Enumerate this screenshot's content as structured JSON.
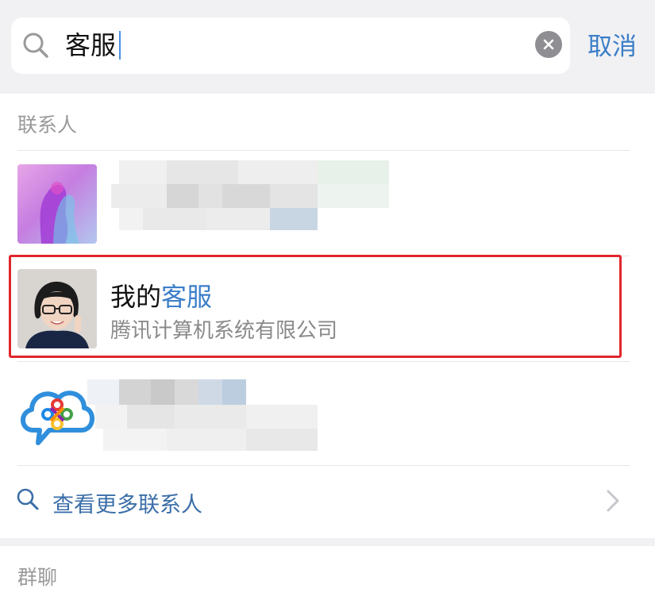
{
  "search": {
    "query": "客服",
    "cancel_label": "取消"
  },
  "contacts": {
    "section_title": "联系人",
    "items": [
      {
        "name": "",
        "subtitle": ""
      },
      {
        "name_prefix": "我的",
        "name_highlight": "客服",
        "subtitle": "腾讯计算机系统有限公司"
      },
      {
        "name": "",
        "subtitle": ""
      }
    ],
    "more_label": "查看更多联系人"
  },
  "groups": {
    "section_title": "群聊"
  },
  "colors": {
    "accent": "#3b7ec8",
    "highlight_border": "#e0262c"
  },
  "icons": {
    "search": "search-icon",
    "clear": "clear-icon",
    "chevron": "chevron-right-icon"
  }
}
